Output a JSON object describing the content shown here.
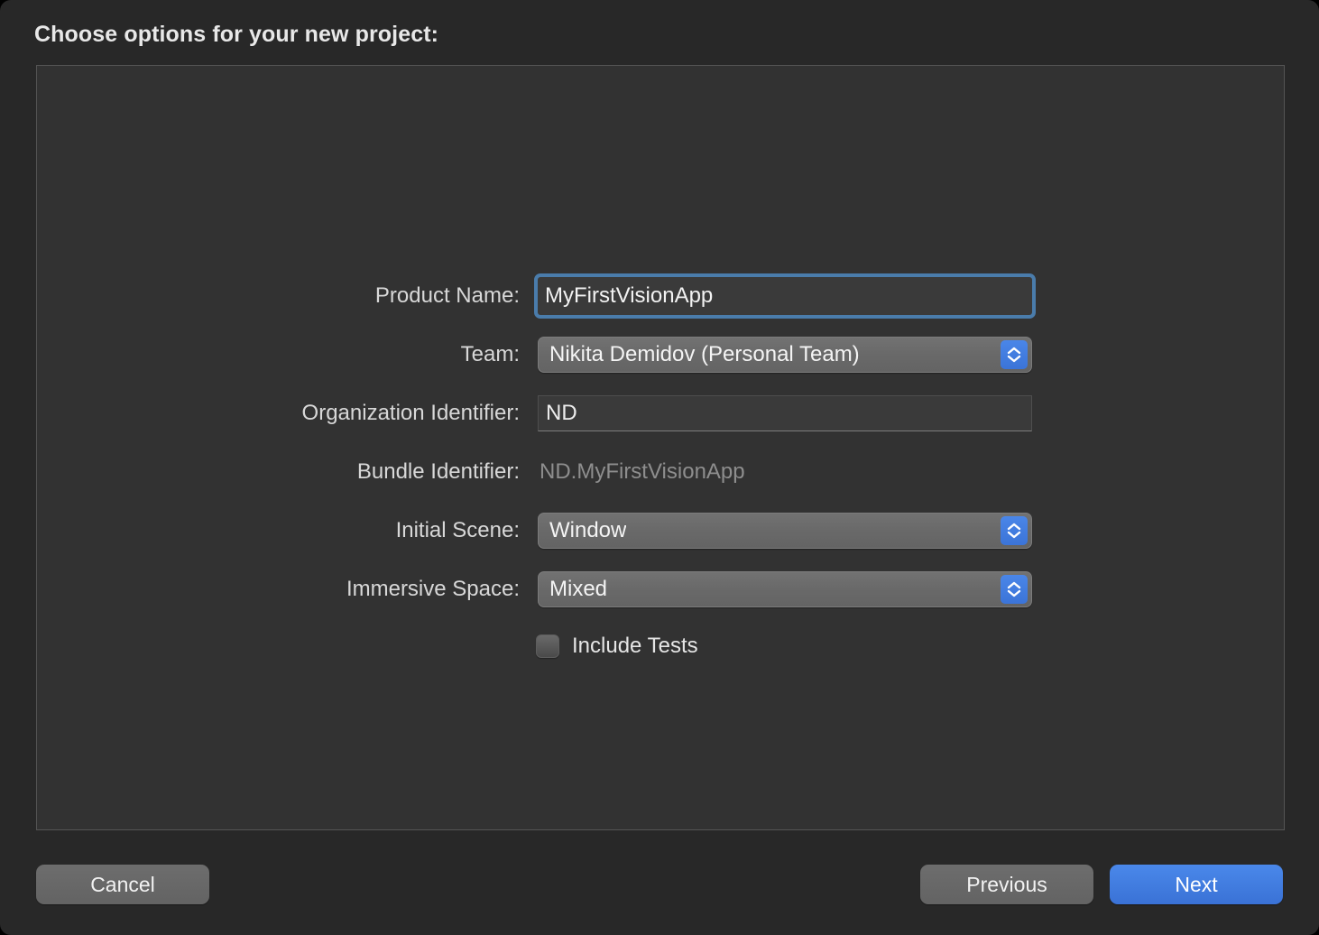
{
  "dialog": {
    "heading": "Choose options for your new project:"
  },
  "form": {
    "rows": [
      {
        "label": "Product Name:",
        "type": "textfield-focused",
        "value": "MyFirstVisionApp"
      },
      {
        "label": "Team:",
        "type": "popup",
        "value": "Nikita Demidov (Personal Team)"
      },
      {
        "label": "Organization Identifier:",
        "type": "textfield",
        "value": "ND"
      },
      {
        "label": "Bundle Identifier:",
        "type": "static",
        "value": "ND.MyFirstVisionApp"
      },
      {
        "label": "Initial Scene:",
        "type": "popup",
        "value": "Window"
      },
      {
        "label": "Immersive Space:",
        "type": "popup",
        "value": "Mixed"
      }
    ],
    "checkbox": {
      "label": "Include Tests",
      "checked": false
    }
  },
  "footer": {
    "cancel_label": "Cancel",
    "previous_label": "Previous",
    "next_label": "Next"
  },
  "colors": {
    "window_background": "#282828",
    "panel_background": "#323232",
    "panel_border": "#545454",
    "accent_blue": "#3b74d8",
    "focus_ring": "#4a7cab",
    "text_primary": "#e8e8e8",
    "text_disabled": "#8e8e8e",
    "control_grey": "#6b6b6b"
  },
  "icons": {
    "stepper": "chevron-up-down-icon"
  }
}
